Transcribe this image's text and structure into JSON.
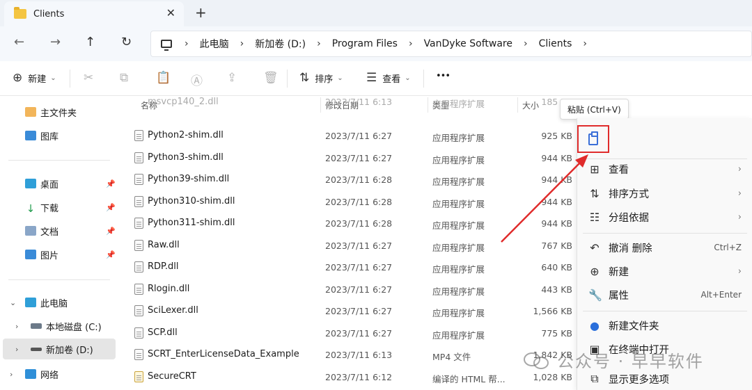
{
  "window": {
    "tab_title": "Clients",
    "tab_close": "✕",
    "new_tab": "+"
  },
  "nav": {
    "back": "←",
    "forward": "→",
    "up": "↑",
    "refresh": "↻"
  },
  "breadcrumb": [
    "此电脑",
    "新加卷 (D:)",
    "Program Files",
    "VanDyke Software",
    "Clients"
  ],
  "breadcrumb_sep": "›",
  "toolbar": {
    "new_label": "新建",
    "sort_label": "排序",
    "view_label": "查看",
    "more_label": "•••"
  },
  "sidebar": {
    "items": [
      {
        "label": "主文件夹"
      },
      {
        "label": "图库"
      },
      {
        "label": "桌面"
      },
      {
        "label": "下载"
      },
      {
        "label": "文档"
      },
      {
        "label": "图片"
      },
      {
        "label": "此电脑"
      },
      {
        "label": "本地磁盘 (C:)"
      },
      {
        "label": "新加卷 (D:)"
      },
      {
        "label": "网络"
      }
    ]
  },
  "columns": {
    "name": "名称",
    "date": "修改日期",
    "type": "类型",
    "size": "大小"
  },
  "files": [
    {
      "name": "msvcp140_2.dll",
      "date": "2023/7/11 6:13",
      "type": "应用程序扩展",
      "size": "185 KB"
    },
    {
      "name": "Python2-shim.dll",
      "date": "2023/7/11 6:27",
      "type": "应用程序扩展",
      "size": "925 KB"
    },
    {
      "name": "Python3-shim.dll",
      "date": "2023/7/11 6:27",
      "type": "应用程序扩展",
      "size": "944 KB"
    },
    {
      "name": "Python39-shim.dll",
      "date": "2023/7/11 6:28",
      "type": "应用程序扩展",
      "size": "944 KB"
    },
    {
      "name": "Python310-shim.dll",
      "date": "2023/7/11 6:28",
      "type": "应用程序扩展",
      "size": "944 KB"
    },
    {
      "name": "Python311-shim.dll",
      "date": "2023/7/11 6:28",
      "type": "应用程序扩展",
      "size": "944 KB"
    },
    {
      "name": "Raw.dll",
      "date": "2023/7/11 6:27",
      "type": "应用程序扩展",
      "size": "767 KB"
    },
    {
      "name": "RDP.dll",
      "date": "2023/7/11 6:27",
      "type": "应用程序扩展",
      "size": "640 KB"
    },
    {
      "name": "Rlogin.dll",
      "date": "2023/7/11 6:27",
      "type": "应用程序扩展",
      "size": "443 KB"
    },
    {
      "name": "SciLexer.dll",
      "date": "2023/7/11 6:27",
      "type": "应用程序扩展",
      "size": "1,566 KB"
    },
    {
      "name": "SCP.dll",
      "date": "2023/7/11 6:27",
      "type": "应用程序扩展",
      "size": "775 KB"
    },
    {
      "name": "SCRT_EnterLicenseData_Example",
      "date": "2023/7/11 6:13",
      "type": "MP4 文件",
      "size": "1,842 KB"
    },
    {
      "name": "SecureCRT",
      "date": "2023/7/11 6:12",
      "type": "编译的 HTML 帮...",
      "size": "1,028 KB"
    }
  ],
  "tooltip": "粘贴 (Ctrl+V)",
  "context_menu": {
    "items": [
      {
        "label": "查看",
        "shortcut": "",
        "submenu": "›"
      },
      {
        "label": "排序方式",
        "shortcut": "",
        "submenu": "›"
      },
      {
        "label": "分组依据",
        "shortcut": "",
        "submenu": "›"
      },
      {
        "label": "撤消 删除",
        "shortcut": "Ctrl+Z",
        "submenu": ""
      },
      {
        "label": "新建",
        "shortcut": "",
        "submenu": "›"
      },
      {
        "label": "属性",
        "shortcut": "Alt+Enter",
        "submenu": ""
      },
      {
        "label": "新建文件夹",
        "shortcut": "",
        "submenu": ""
      },
      {
        "label": "在终端中打开",
        "shortcut": "",
        "submenu": ""
      },
      {
        "label": "显示更多选项",
        "shortcut": "",
        "submenu": ""
      }
    ]
  },
  "watermark": "公众号 · 早早软件",
  "colors": {
    "highlight_red": "#e02b2b",
    "accent_blue": "#3a6fd8"
  }
}
